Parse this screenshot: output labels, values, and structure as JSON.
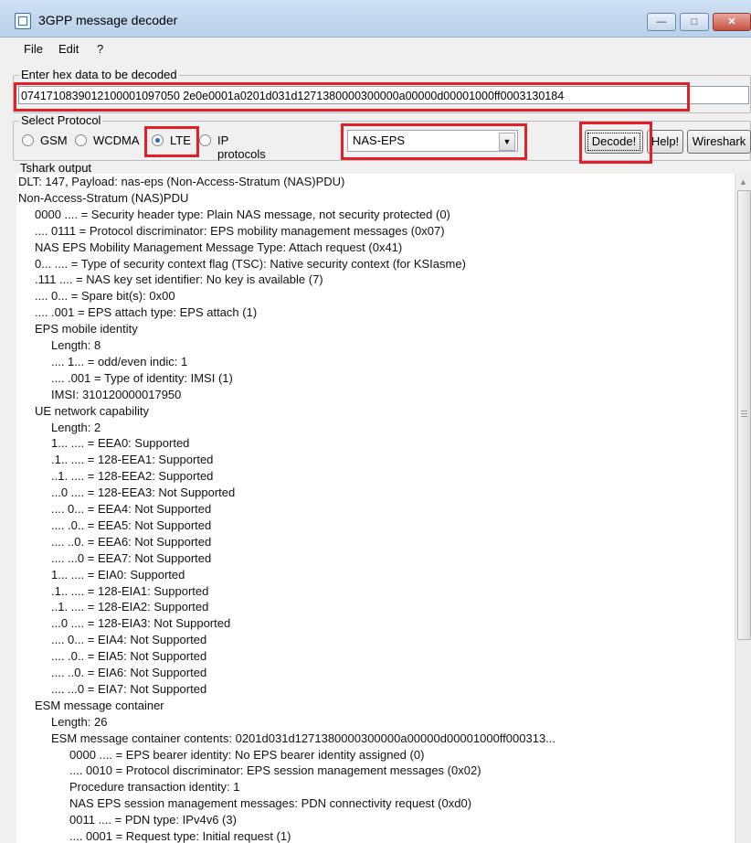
{
  "window": {
    "title": "3GPP message decoder"
  },
  "menu": [
    "File",
    "Edit",
    "?"
  ],
  "hex": {
    "label": "Enter hex data to be decoded",
    "value": "0741710839012100001097050 2e0e0001a0201d031d1271380000300000a00000d00001000ff0003130184"
  },
  "protocol": {
    "label": "Select Protocol",
    "options": [
      "GSM",
      "WCDMA",
      "LTE",
      "IP protocols"
    ],
    "selected": "LTE",
    "combo_value": "NAS-EPS"
  },
  "buttons": {
    "decode": "Decode!",
    "help": "Help!",
    "wireshark": "Wireshark"
  },
  "output": {
    "label": "Tshark output",
    "lines": [
      {
        "indent": 0,
        "text": "DLT: 147, Payload: nas-eps (Non-Access-Stratum (NAS)PDU)"
      },
      {
        "indent": 0,
        "text": "Non-Access-Stratum (NAS)PDU"
      },
      {
        "indent": 1,
        "text": "0000 .... = Security header type: Plain NAS message, not security protected (0)"
      },
      {
        "indent": 1,
        "text": ".... 0111 = Protocol discriminator: EPS mobility management messages (0x07)"
      },
      {
        "indent": 1,
        "text": "NAS EPS Mobility Management Message Type: Attach request (0x41)"
      },
      {
        "indent": 1,
        "text": "0... .... = Type of security context flag (TSC): Native security context (for KSIasme)"
      },
      {
        "indent": 1,
        "text": ".111 .... = NAS key set identifier: No key is available (7)"
      },
      {
        "indent": 1,
        "text": ".... 0... = Spare bit(s): 0x00"
      },
      {
        "indent": 1,
        "text": ".... .001 = EPS attach type: EPS attach (1)"
      },
      {
        "indent": 1,
        "text": "EPS mobile identity"
      },
      {
        "indent": 2,
        "text": "Length: 8"
      },
      {
        "indent": 2,
        "text": ".... 1... = odd/even indic: 1"
      },
      {
        "indent": 2,
        "text": ".... .001 = Type of identity: IMSI (1)"
      },
      {
        "indent": 2,
        "text": "IMSI: 310120000017950"
      },
      {
        "indent": 1,
        "text": "UE network capability"
      },
      {
        "indent": 2,
        "text": "Length: 2"
      },
      {
        "indent": 2,
        "text": "1... .... = EEA0: Supported"
      },
      {
        "indent": 2,
        "text": ".1.. .... = 128-EEA1: Supported"
      },
      {
        "indent": 2,
        "text": "..1. .... = 128-EEA2: Supported"
      },
      {
        "indent": 2,
        "text": "...0 .... = 128-EEA3: Not Supported"
      },
      {
        "indent": 2,
        "text": ".... 0... = EEA4: Not Supported"
      },
      {
        "indent": 2,
        "text": ".... .0.. = EEA5: Not Supported"
      },
      {
        "indent": 2,
        "text": ".... ..0. = EEA6: Not Supported"
      },
      {
        "indent": 2,
        "text": ".... ...0 = EEA7: Not Supported"
      },
      {
        "indent": 2,
        "text": "1... .... = EIA0: Supported"
      },
      {
        "indent": 2,
        "text": ".1.. .... = 128-EIA1: Supported"
      },
      {
        "indent": 2,
        "text": "..1. .... = 128-EIA2: Supported"
      },
      {
        "indent": 2,
        "text": "...0 .... = 128-EIA3: Not Supported"
      },
      {
        "indent": 2,
        "text": ".... 0... = EIA4: Not Supported"
      },
      {
        "indent": 2,
        "text": ".... .0.. = EIA5: Not Supported"
      },
      {
        "indent": 2,
        "text": ".... ..0. = EIA6: Not Supported"
      },
      {
        "indent": 2,
        "text": ".... ...0 = EIA7: Not Supported"
      },
      {
        "indent": 1,
        "text": "ESM message container"
      },
      {
        "indent": 2,
        "text": "Length: 26"
      },
      {
        "indent": 2,
        "text": "ESM message container contents: 0201d031d1271380000300000a00000d00001000ff000313..."
      },
      {
        "indent": 3,
        "text": "0000 .... = EPS bearer identity: No EPS bearer identity assigned (0)"
      },
      {
        "indent": 3,
        "text": ".... 0010 = Protocol discriminator: EPS session management messages (0x02)"
      },
      {
        "indent": 3,
        "text": "Procedure transaction identity: 1"
      },
      {
        "indent": 3,
        "text": "NAS EPS session management messages: PDN connectivity request (0xd0)"
      },
      {
        "indent": 3,
        "text": "0011 .... = PDN type: IPv4v6 (3)"
      },
      {
        "indent": 3,
        "text": ".... 0001 = Request type: Initial request (1)"
      }
    ]
  }
}
